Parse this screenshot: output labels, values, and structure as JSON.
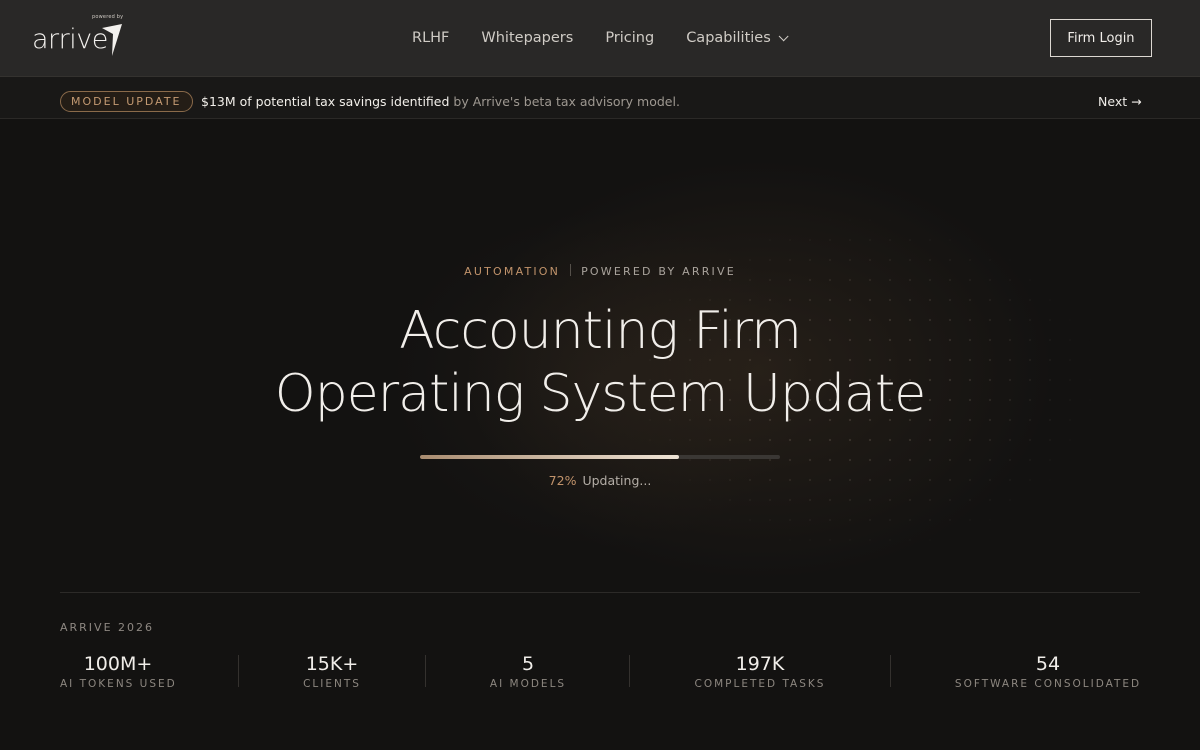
{
  "logo": {
    "powered_by": "powered by",
    "wordmark": "arrive"
  },
  "nav": {
    "items": [
      {
        "label": "RLHF"
      },
      {
        "label": "Whitepapers"
      },
      {
        "label": "Pricing"
      },
      {
        "label": "Capabilities"
      }
    ],
    "login_label": "Firm Login"
  },
  "announcement": {
    "badge": "MODEL UPDATE",
    "highlight": "$13M of potential tax savings identified",
    "rest": " by Arrive's beta tax advisory model.",
    "next_label": "Next →"
  },
  "hero": {
    "eyebrow_accent": "AUTOMATION",
    "eyebrow_muted": "POWERED BY ARRIVE",
    "title_line1": "Accounting Firm",
    "title_line2": "Operating System Update",
    "progress_percent": 72,
    "progress_text": "72%",
    "status_text": "Updating..."
  },
  "stats": {
    "label": "ARRIVE 2026",
    "items": [
      {
        "value": "100M+",
        "label": "AI TOKENS USED"
      },
      {
        "value": "15K+",
        "label": "CLIENTS"
      },
      {
        "value": "5",
        "label": "AI MODELS"
      },
      {
        "value": "197K",
        "label": "COMPLETED TASKS"
      },
      {
        "value": "54",
        "label": "SOFTWARE CONSOLIDATED"
      }
    ]
  },
  "colors": {
    "background": "#131211",
    "header": "#292827",
    "accent": "#c1936b",
    "text": "#f1eeea"
  }
}
